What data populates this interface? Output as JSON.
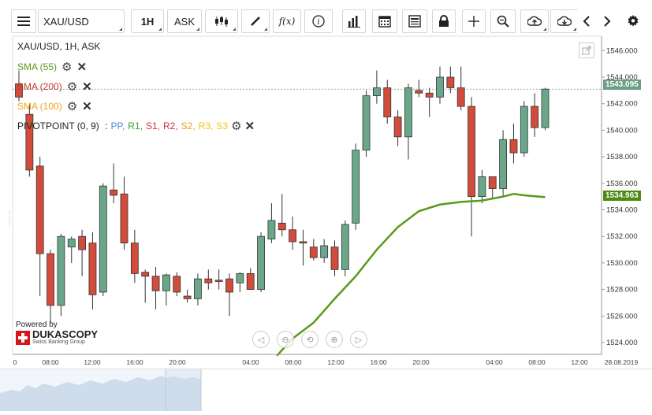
{
  "toolbar": {
    "symbol": "XAU/USD",
    "timeframe": "1H",
    "side": "ASK",
    "buttons": [
      "menu-icon",
      "candles-icon",
      "draw-icon",
      "fx-icon",
      "info-icon",
      "bars-icon",
      "calendar-icon",
      "news-icon",
      "lock-icon",
      "crosshair-icon",
      "zoom-icon",
      "upload-icon",
      "download-icon",
      "prev-icon",
      "next-icon",
      "gear-icon"
    ]
  },
  "legend": {
    "title": "XAU/USD, 1H, ASK",
    "sma55": "SMA (55)",
    "sma200": "SMA (200)",
    "sma100": "SMA (100)",
    "pivot": "PIVOTPOINT (0, 9)",
    "pivot_items": [
      "PP,",
      "R1,",
      "S1,",
      "R2,",
      "S2,",
      "R3,",
      "S3"
    ],
    "colors": {
      "sma55": "#5a9a1a",
      "sma200": "#c0392b",
      "sma100": "#f2a31c",
      "pp": "#3d8fd9",
      "r1": "#3a9e3a",
      "s1": "#d53030",
      "r2": "#d53030",
      "s2": "#f29d1c",
      "r3": "#f2c21c",
      "s3": "#f2c21c"
    }
  },
  "logo": {
    "powered": "Powered by",
    "brand": "DUKASCOPY",
    "sub": "Swiss Banking Group"
  },
  "price_labels": {
    "last": "1543.095",
    "sma": "1534.963"
  },
  "chart_data": {
    "type": "candlestick",
    "title": "XAU/USD, 1H, ASK",
    "ylim": [
      1523,
      1547
    ],
    "yticks": [
      "1524.000",
      "1526.000",
      "1528.000",
      "1530.000",
      "1532.000",
      "1534.000",
      "1536.000",
      "1538.000",
      "1540.000",
      "1542.000",
      "1544.000",
      "1546.000"
    ],
    "xticks": [
      "0",
      "08:00",
      "12:00",
      "16:00",
      "20:00",
      "04:00",
      "08:00",
      "12:00",
      "16:00",
      "20:00",
      "04:00",
      "08:00",
      "12:00",
      "28.08.2019"
    ],
    "candles": [
      {
        "o": 1543.5,
        "h": 1544.5,
        "l": 1542.2,
        "c": 1542.5
      },
      {
        "o": 1541.2,
        "h": 1542.0,
        "l": 1536.5,
        "c": 1537.0
      },
      {
        "o": 1537.3,
        "h": 1538.0,
        "l": 1527.5,
        "c": 1530.7
      },
      {
        "o": 1530.7,
        "h": 1531.0,
        "l": 1525.5,
        "c": 1526.8
      },
      {
        "o": 1526.8,
        "h": 1532.2,
        "l": 1526.0,
        "c": 1532.0
      },
      {
        "o": 1531.2,
        "h": 1532.0,
        "l": 1530.0,
        "c": 1531.8
      },
      {
        "o": 1532.0,
        "h": 1532.5,
        "l": 1529.0,
        "c": 1531.0
      },
      {
        "o": 1531.5,
        "h": 1532.3,
        "l": 1526.5,
        "c": 1527.6
      },
      {
        "o": 1527.8,
        "h": 1536.0,
        "l": 1527.5,
        "c": 1535.8
      },
      {
        "o": 1535.5,
        "h": 1537.5,
        "l": 1534.5,
        "c": 1535.1
      },
      {
        "o": 1535.2,
        "h": 1536.5,
        "l": 1531.0,
        "c": 1531.5
      },
      {
        "o": 1531.5,
        "h": 1532.5,
        "l": 1528.5,
        "c": 1529.2
      },
      {
        "o": 1529.3,
        "h": 1529.5,
        "l": 1527.0,
        "c": 1529.0
      },
      {
        "o": 1529.0,
        "h": 1529.7,
        "l": 1526.5,
        "c": 1527.9
      },
      {
        "o": 1527.9,
        "h": 1529.2,
        "l": 1526.8,
        "c": 1529.1
      },
      {
        "o": 1529.0,
        "h": 1529.3,
        "l": 1527.5,
        "c": 1527.8
      },
      {
        "o": 1527.5,
        "h": 1528.0,
        "l": 1527.0,
        "c": 1527.3
      },
      {
        "o": 1527.3,
        "h": 1529.2,
        "l": 1526.8,
        "c": 1528.8
      },
      {
        "o": 1528.8,
        "h": 1529.5,
        "l": 1528.0,
        "c": 1528.5
      },
      {
        "o": 1528.7,
        "h": 1529.5,
        "l": 1528.0,
        "c": 1528.6
      },
      {
        "o": 1528.8,
        "h": 1529.2,
        "l": 1526.0,
        "c": 1527.8
      },
      {
        "o": 1528.5,
        "h": 1529.3,
        "l": 1527.8,
        "c": 1529.2
      },
      {
        "o": 1529.2,
        "h": 1529.6,
        "l": 1528.2,
        "c": 1528.0
      },
      {
        "o": 1528.0,
        "h": 1532.3,
        "l": 1527.8,
        "c": 1532.0
      },
      {
        "o": 1531.8,
        "h": 1534.5,
        "l": 1531.5,
        "c": 1533.2
      },
      {
        "o": 1533.0,
        "h": 1535.2,
        "l": 1532.0,
        "c": 1532.5
      },
      {
        "o": 1532.5,
        "h": 1533.5,
        "l": 1531.0,
        "c": 1531.6
      },
      {
        "o": 1531.6,
        "h": 1532.5,
        "l": 1529.8,
        "c": 1531.5
      },
      {
        "o": 1531.2,
        "h": 1531.8,
        "l": 1530.2,
        "c": 1530.4
      },
      {
        "o": 1530.4,
        "h": 1531.8,
        "l": 1530.0,
        "c": 1531.3
      },
      {
        "o": 1531.2,
        "h": 1531.7,
        "l": 1529.0,
        "c": 1529.5
      },
      {
        "o": 1529.5,
        "h": 1533.2,
        "l": 1529.0,
        "c": 1532.9
      },
      {
        "o": 1533.0,
        "h": 1539.0,
        "l": 1532.5,
        "c": 1538.5
      },
      {
        "o": 1538.5,
        "h": 1543.0,
        "l": 1538.0,
        "c": 1542.6
      },
      {
        "o": 1542.6,
        "h": 1544.5,
        "l": 1542.0,
        "c": 1543.2
      },
      {
        "o": 1543.2,
        "h": 1543.8,
        "l": 1540.5,
        "c": 1541.0
      },
      {
        "o": 1541.0,
        "h": 1541.5,
        "l": 1538.8,
        "c": 1539.5
      },
      {
        "o": 1539.5,
        "h": 1543.5,
        "l": 1537.8,
        "c": 1543.2
      },
      {
        "o": 1543.0,
        "h": 1543.8,
        "l": 1542.5,
        "c": 1542.8
      },
      {
        "o": 1542.8,
        "h": 1543.2,
        "l": 1541.0,
        "c": 1542.5
      },
      {
        "o": 1542.5,
        "h": 1544.8,
        "l": 1542.0,
        "c": 1544.0
      },
      {
        "o": 1544.0,
        "h": 1544.8,
        "l": 1542.8,
        "c": 1543.2
      },
      {
        "o": 1543.2,
        "h": 1544.8,
        "l": 1541.5,
        "c": 1541.8
      },
      {
        "o": 1541.8,
        "h": 1542.5,
        "l": 1532.0,
        "c": 1535.0
      },
      {
        "o": 1535.0,
        "h": 1537.0,
        "l": 1534.5,
        "c": 1536.5
      },
      {
        "o": 1536.5,
        "h": 1536.5,
        "l": 1534.8,
        "c": 1535.6
      },
      {
        "o": 1535.6,
        "h": 1540.0,
        "l": 1535.0,
        "c": 1539.3
      },
      {
        "o": 1539.3,
        "h": 1540.5,
        "l": 1537.5,
        "c": 1538.3
      },
      {
        "o": 1538.3,
        "h": 1542.2,
        "l": 1538.0,
        "c": 1541.8
      },
      {
        "o": 1541.8,
        "h": 1542.8,
        "l": 1539.5,
        "c": 1540.2
      },
      {
        "o": 1540.2,
        "h": 1543.2,
        "l": 1540.0,
        "c": 1543.1
      }
    ],
    "sma55": [
      [
        24.5,
        1523.0
      ],
      [
        26,
        1524.3
      ],
      [
        28,
        1525.5
      ],
      [
        30,
        1527.3
      ],
      [
        32,
        1529.0
      ],
      [
        34,
        1531.0
      ],
      [
        36,
        1532.7
      ],
      [
        38,
        1533.9
      ],
      [
        40,
        1534.4
      ],
      [
        42,
        1534.6
      ],
      [
        44,
        1534.7
      ],
      [
        46,
        1535.0
      ],
      [
        47,
        1535.2
      ],
      [
        48,
        1535.1
      ],
      [
        50,
        1534.96
      ]
    ]
  }
}
